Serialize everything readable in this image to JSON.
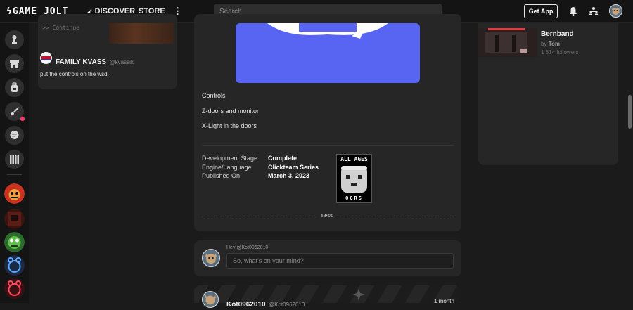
{
  "topbar": {
    "logo": "GAME JOLT",
    "nav": {
      "discover": "DISCOVER",
      "store": "STORE"
    },
    "search_placeholder": "Search",
    "get_app": "Get App"
  },
  "feed_left": {
    "code_snippet": ">> Continue",
    "comment": {
      "name": "FAMILY KVASS",
      "handle": "@kvassik",
      "text": "put the controls on the wsd."
    }
  },
  "game": {
    "description_lines": [
      "Controls",
      "Z-doors and monitor",
      "X-Light in the doors"
    ],
    "info": [
      {
        "label": "Development Stage",
        "value": "Complete"
      },
      {
        "label": "Engine/Language",
        "value": "Clickteam Series"
      },
      {
        "label": "Published On",
        "value": "March 3, 2023"
      }
    ],
    "rating": {
      "top": "ALL AGES",
      "bottom": "OGRS"
    },
    "less_label": "Less"
  },
  "composer": {
    "hint": "Hey @Kot0962010",
    "placeholder": "So, what's on your mind?"
  },
  "post_preview": {
    "name": "Kot0962010",
    "handle": "@Kot0962010",
    "time": "1 month"
  },
  "recommended": {
    "title": "Bernband",
    "by_prefix": "by",
    "author": "Tom",
    "followers": "1 814 followers"
  },
  "colors": {
    "discord_blue": "#5865F2",
    "notification_pink": "#ff3a6a",
    "card_bg": "#262626"
  }
}
